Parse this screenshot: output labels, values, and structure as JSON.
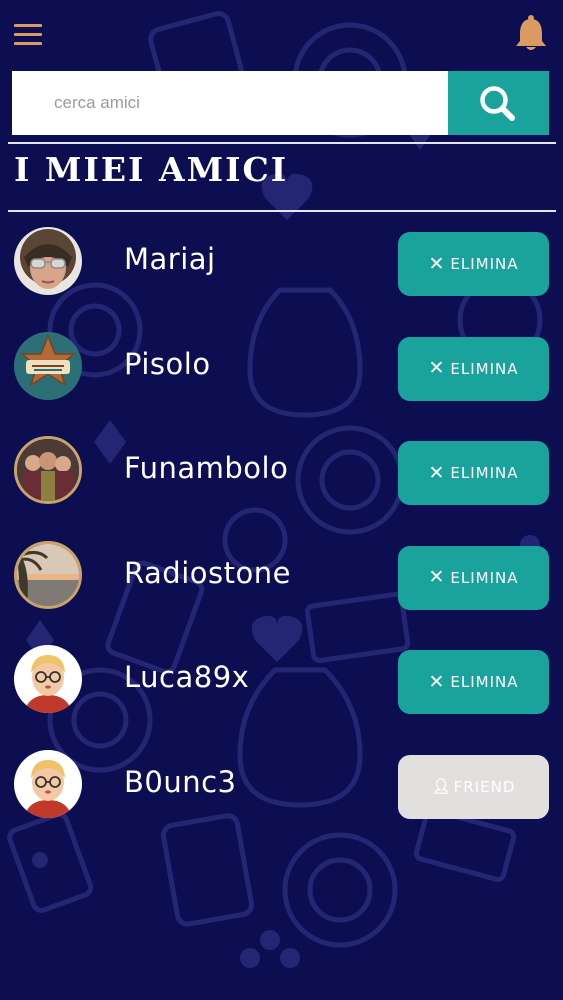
{
  "header": {
    "menu_icon": "hamburger-menu-icon",
    "bell_icon": "notification-bell-icon"
  },
  "search": {
    "placeholder": "cerca amici",
    "value": "",
    "button_icon": "search-icon"
  },
  "section": {
    "title": "I MIEI AMICI"
  },
  "friends": [
    {
      "name": "Mariaj",
      "action_label": "ELIMINA",
      "action_icon": "close-icon"
    },
    {
      "name": "Pisolo",
      "action_label": "ELIMINA",
      "action_icon": "close-icon"
    },
    {
      "name": "Funambolo",
      "action_label": "ELIMINA",
      "action_icon": "close-icon"
    },
    {
      "name": "Radiostone",
      "action_label": "ELIMINA",
      "action_icon": "close-icon"
    },
    {
      "name": "Luca89x",
      "action_label": "ELIMINA",
      "action_icon": "close-icon"
    },
    {
      "name": "B0unc3",
      "action_label": "FRIEND",
      "action_icon": "person-icon"
    }
  ],
  "colors": {
    "background": "#0d0e52",
    "accent": "#1aa39c",
    "icon_orange": "#d99b5f",
    "friend_button": "#e2dfdf"
  }
}
